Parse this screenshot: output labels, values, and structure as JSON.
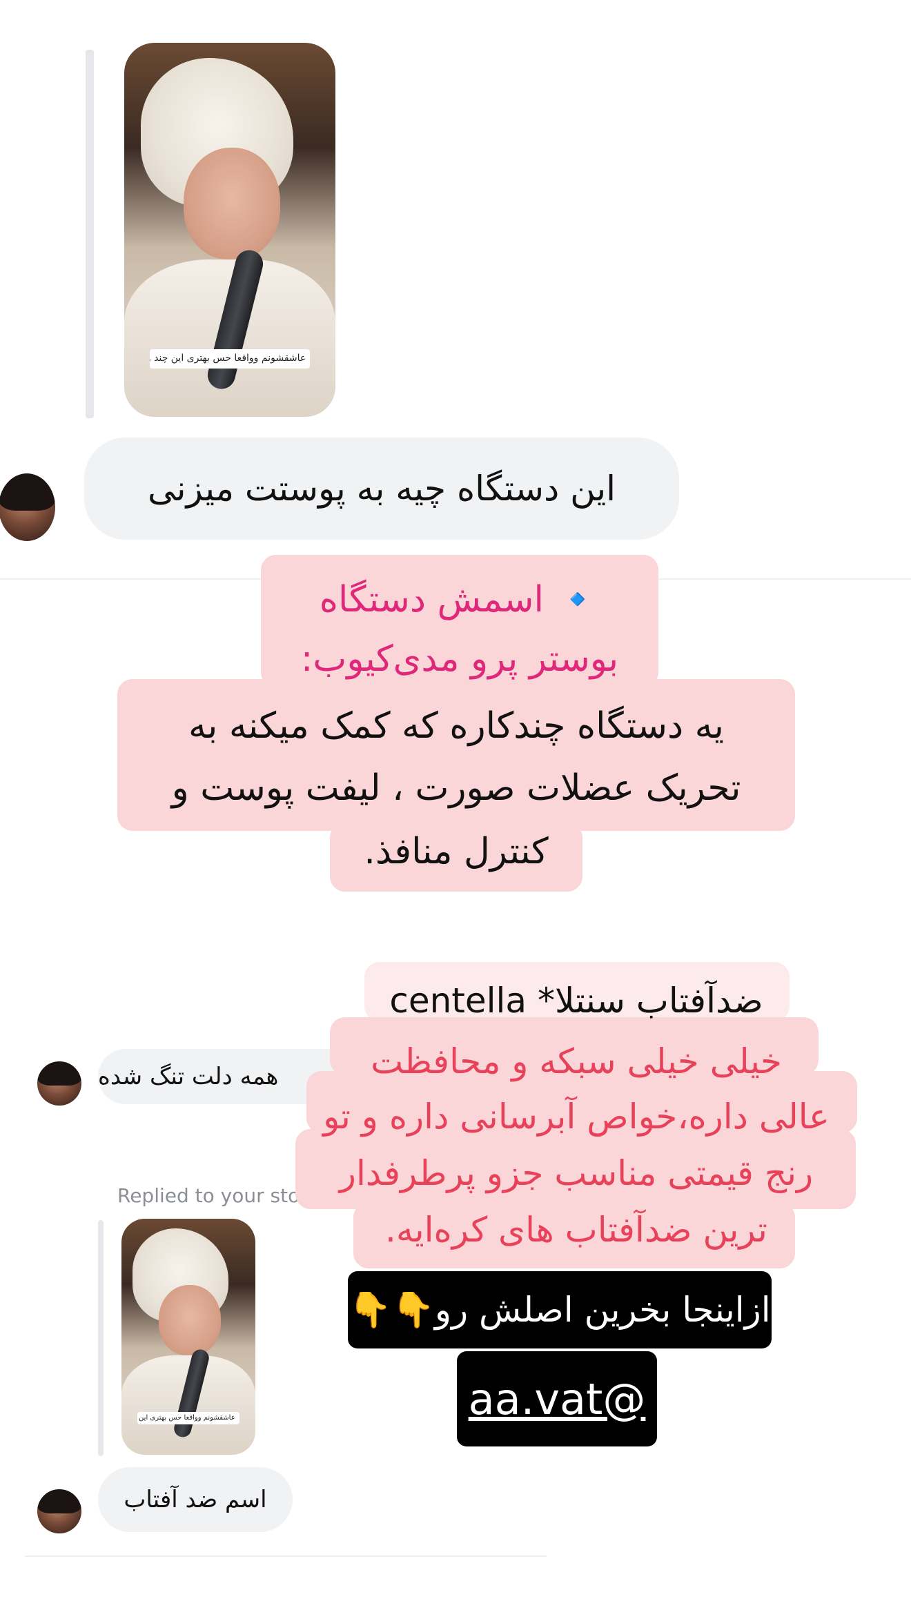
{
  "story_thumb_1": {
    "sticker_text": "عاشقشونم وواقعا حس بهتری این چند وقت دارم ❤️"
  },
  "message_1": {
    "text": "این دستگاه چیه به پوستت میزنی"
  },
  "story_overlay_1": {
    "title_icon": "🔹",
    "title_line1": "اسمش دستگاه",
    "title_line2": "بوستر پرو مدی‌کیوب:",
    "body_line1": "یه دستگاه چندکاره که کمک میکنه به",
    "body_line2": "تحریک عضلات صورت ، لیفت پوست و",
    "body_line3": "کنترل منافذ."
  },
  "partial_message": {
    "text": "همه دلت تنگ شده"
  },
  "replied_to_story": {
    "text": "Replied to your sto"
  },
  "story_thumb_2": {
    "sticker_text": "عاشقشونم وواقعا حس بهتری این چند وقت دارم ❤️"
  },
  "message_2": {
    "text": "اسم ضد آفتاب"
  },
  "story_overlay_2": {
    "line1": "ضدآفتاب سنتلا* centella",
    "line2": "خیلی خیلی سبکه و محافظت",
    "line3": "عالی داره،خواص آبرسانی داره و تو",
    "line4": "رنج قیمتی مناسب جزو پرطرفدار",
    "line5": "ترین ضدآفتاب های کره‌ایه."
  },
  "cta_label": {
    "text": "ازاینجا بخرین اصلش رو👇👇"
  },
  "handle_label": {
    "text": "@aa.vat"
  },
  "colors": {
    "pink_block": "#fad6d8",
    "magenta_text": "#e0287a",
    "red_text": "#e8425a",
    "bubble_gray": "#f1f2f4",
    "label_black": "#000000"
  },
  "icons": {
    "title_icon": "blue-diamond-icon",
    "pointing_icon": "backhand-index-pointing-down-icon",
    "sticker_icon": "red-heart-icon"
  }
}
